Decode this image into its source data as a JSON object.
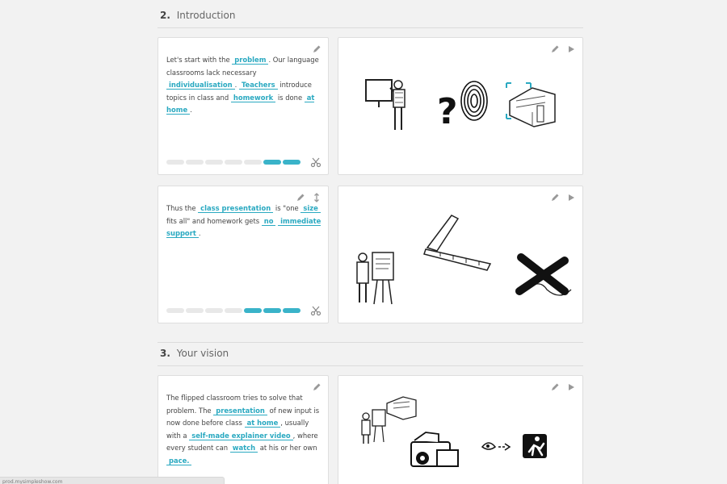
{
  "sections": [
    {
      "number": "2.",
      "title": "Introduction"
    },
    {
      "number": "3.",
      "title": "Your vision"
    }
  ],
  "scenes": [
    {
      "parts": [
        {
          "t": "Let's start with the "
        },
        {
          "b": "problem"
        },
        {
          "t": ". Our language classrooms lack necessary "
        },
        {
          "b": "individualisation"
        },
        {
          "t": ". "
        },
        {
          "b": "Teachers"
        },
        {
          "t": " introduce topics in class and "
        },
        {
          "b": "homework"
        },
        {
          "t": " is done "
        },
        {
          "b": "at home"
        },
        {
          "t": "."
        }
      ],
      "progress_total": 7,
      "progress_filled": 2
    },
    {
      "parts": [
        {
          "t": "Thus the "
        },
        {
          "b": "class presentation"
        },
        {
          "t": " is \"one "
        },
        {
          "b": "size"
        },
        {
          "t": " fits all\" and homework gets "
        },
        {
          "b": "no"
        },
        {
          "t": " "
        },
        {
          "b": "immediate support"
        },
        {
          "t": "."
        }
      ],
      "progress_total": 7,
      "progress_filled": 3
    },
    {
      "parts": [
        {
          "t": "The flipped classroom tries to solve that problem. The "
        },
        {
          "b": "presentation"
        },
        {
          "t": " of new input is now done before class "
        },
        {
          "b": "at home"
        },
        {
          "t": ", usually with a "
        },
        {
          "b": "self-made explainer video"
        },
        {
          "t": ", where every student can "
        },
        {
          "b": "watch"
        },
        {
          "t": " at his or her own "
        },
        {
          "b": "pace."
        }
      ]
    }
  ],
  "icons": {
    "edit": "pencil-icon",
    "play": "play-icon",
    "cut": "scissors-icon",
    "split": "split-arrows-icon"
  },
  "colors": {
    "accent": "#3ab3c9",
    "blank_text": "#2aa9c1",
    "progress_empty": "#e8e8e8"
  },
  "status_bar": {
    "text": "prod.mysimpleshow.com"
  }
}
